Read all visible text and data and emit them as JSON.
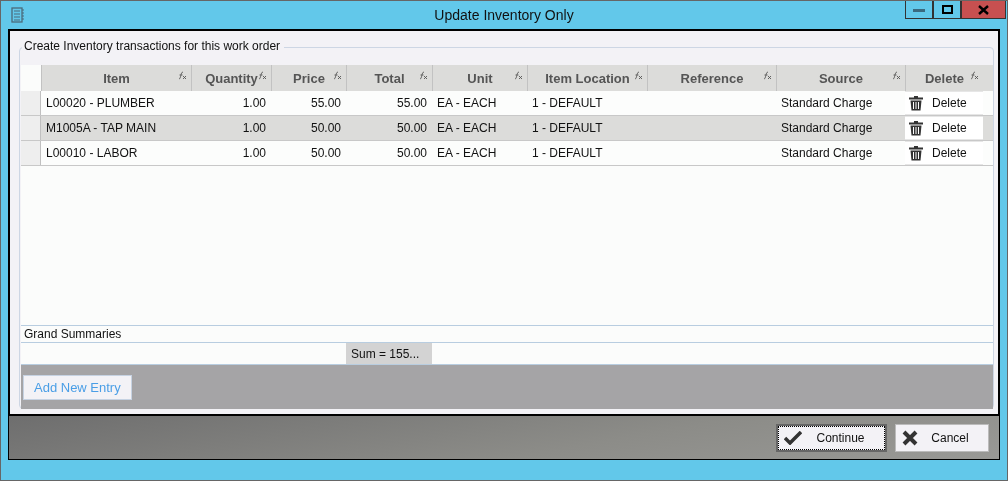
{
  "window": {
    "title": "Update Inventory Only"
  },
  "group": {
    "legend": "Create Inventory transactions for this work order"
  },
  "table": {
    "columns": [
      {
        "label": "Item"
      },
      {
        "label": "Quantity"
      },
      {
        "label": "Price"
      },
      {
        "label": "Total"
      },
      {
        "label": "Unit"
      },
      {
        "label": "Item Location"
      },
      {
        "label": "Reference"
      },
      {
        "label": "Source"
      },
      {
        "label": "Delete"
      }
    ],
    "rows": [
      {
        "selected": false,
        "cells": [
          "L00020 - PLUMBER",
          "1.00",
          "55.00",
          "55.00",
          "EA - EACH",
          "1 - DEFAULT",
          "",
          "Standard Charge"
        ],
        "delete": "Delete"
      },
      {
        "selected": true,
        "cells": [
          "M1005A - TAP MAIN",
          "1.00",
          "50.00",
          "50.00",
          "EA - EACH",
          "1 - DEFAULT",
          "",
          "Standard Charge"
        ],
        "delete": "Delete"
      },
      {
        "selected": false,
        "cells": [
          "L00010 - LABOR",
          "1.00",
          "50.00",
          "50.00",
          "EA - EACH",
          "1 - DEFAULT",
          "",
          "Standard Charge"
        ],
        "delete": "Delete"
      }
    ]
  },
  "summaries": {
    "title": "Grand Summaries",
    "sum": "Sum = 155..."
  },
  "add_button": "Add New Entry",
  "buttons": [
    {
      "kind": "continue",
      "label": "Continue"
    },
    {
      "kind": "cancel",
      "label": "Cancel"
    }
  ]
}
